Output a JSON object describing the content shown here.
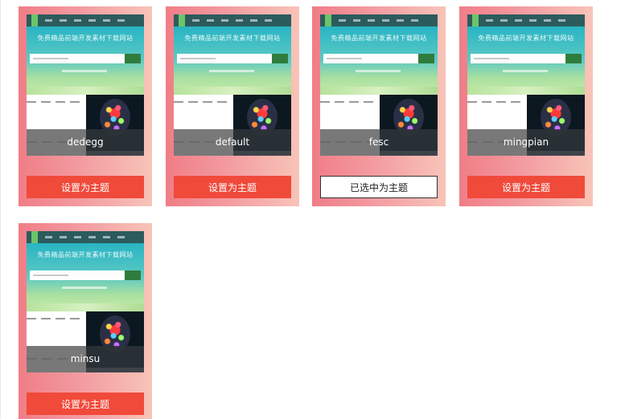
{
  "preview": {
    "headline": "免费精品前端开发素材下载网站"
  },
  "themes": [
    {
      "name": "dedegg",
      "button_label": "设置为主题",
      "selected": false
    },
    {
      "name": "default",
      "button_label": "设置为主题",
      "selected": false
    },
    {
      "name": "fesc",
      "button_label": "已选中为主题",
      "selected": true
    },
    {
      "name": "mingpian",
      "button_label": "设置为主题",
      "selected": false
    },
    {
      "name": "minsu",
      "button_label": "设置为主题",
      "selected": false
    }
  ],
  "colors": {
    "button_red": "#f04a3b",
    "card_gradient_start": "#f07d86",
    "card_gradient_end": "#f8c4b8",
    "selected_button_bg": "#ffffff"
  }
}
